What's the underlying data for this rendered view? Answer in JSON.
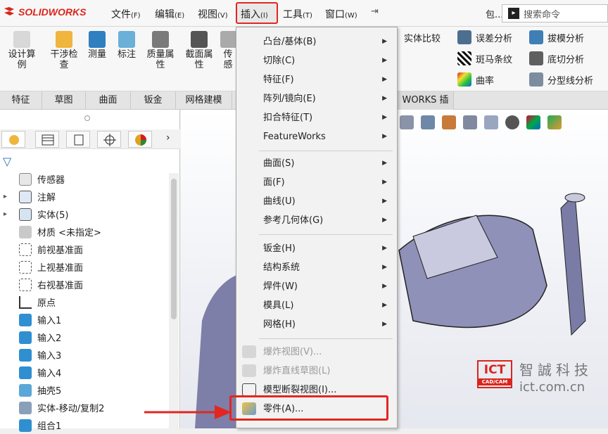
{
  "app": {
    "name": "SOLIDWORKS"
  },
  "menubar": {
    "items": [
      {
        "label": "文件",
        "key": "(F)"
      },
      {
        "label": "编辑",
        "key": "(E)"
      },
      {
        "label": "视图",
        "key": "(V)"
      },
      {
        "label": "插入",
        "key": "(I)"
      },
      {
        "label": "工具",
        "key": "(T)"
      },
      {
        "label": "窗口",
        "key": "(W)"
      }
    ],
    "overflow": "包..."
  },
  "search": {
    "placeholder": "搜索命令"
  },
  "ribbon": {
    "left": [
      "设计算例",
      "干涉检查",
      "测量",
      "标注",
      "质量属性",
      "截面属性",
      "传感"
    ],
    "right": [
      "实体比较",
      "误差分析",
      "拔模分析",
      "斑马条纹",
      "底切分析",
      "曲率",
      "分型线分析"
    ]
  },
  "tabs": [
    "特征",
    "草图",
    "曲面",
    "钣金",
    "网格建模",
    "WORKS 插件"
  ],
  "tree": [
    {
      "label": "传感器",
      "expand": ""
    },
    {
      "label": "注解",
      "expand": "▸"
    },
    {
      "label": "实体(5)",
      "expand": "▸"
    },
    {
      "label": "材质 <未指定>",
      "expand": ""
    },
    {
      "label": "前视基准面",
      "expand": ""
    },
    {
      "label": "上视基准面",
      "expand": ""
    },
    {
      "label": "右视基准面",
      "expand": ""
    },
    {
      "label": "原点",
      "expand": ""
    },
    {
      "label": "输入1",
      "expand": ""
    },
    {
      "label": "输入2",
      "expand": ""
    },
    {
      "label": "输入3",
      "expand": ""
    },
    {
      "label": "输入4",
      "expand": ""
    },
    {
      "label": "抽壳5",
      "expand": ""
    },
    {
      "label": "实体-移动/复制2",
      "expand": ""
    },
    {
      "label": "组合1",
      "expand": ""
    }
  ],
  "dropdown": [
    {
      "label": "凸台/基体(B)",
      "sub": true
    },
    {
      "label": "切除(C)",
      "sub": true
    },
    {
      "label": "特征(F)",
      "sub": true
    },
    {
      "label": "阵列/镜向(E)",
      "sub": true
    },
    {
      "label": "扣合特征(T)",
      "sub": true
    },
    {
      "label": "FeatureWorks",
      "sub": true
    },
    {
      "label": "曲面(S)",
      "sub": true
    },
    {
      "label": "面(F)",
      "sub": true
    },
    {
      "label": "曲线(U)",
      "sub": true
    },
    {
      "label": "参考几何体(G)",
      "sub": true
    },
    {
      "label": "钣金(H)",
      "sub": true
    },
    {
      "label": "结构系统",
      "sub": true
    },
    {
      "label": "焊件(W)",
      "sub": true
    },
    {
      "label": "模具(L)",
      "sub": true
    },
    {
      "label": "网格(H)",
      "sub": true
    },
    {
      "label": "爆炸视图(V)...",
      "sub": false,
      "disabled": true
    },
    {
      "label": "爆炸直线草图(L)",
      "sub": false,
      "disabled": true
    },
    {
      "label": "模型断裂视图(I)...",
      "sub": false
    },
    {
      "label": "零件(A)...",
      "sub": false
    }
  ],
  "watermark": {
    "logo": "ICT",
    "logo_sub": "CAD/CAM",
    "name": "智誠科技",
    "url": "ict.com.cn"
  },
  "colors": {
    "accent": "#d9261c",
    "highlight": "#e3261f"
  }
}
